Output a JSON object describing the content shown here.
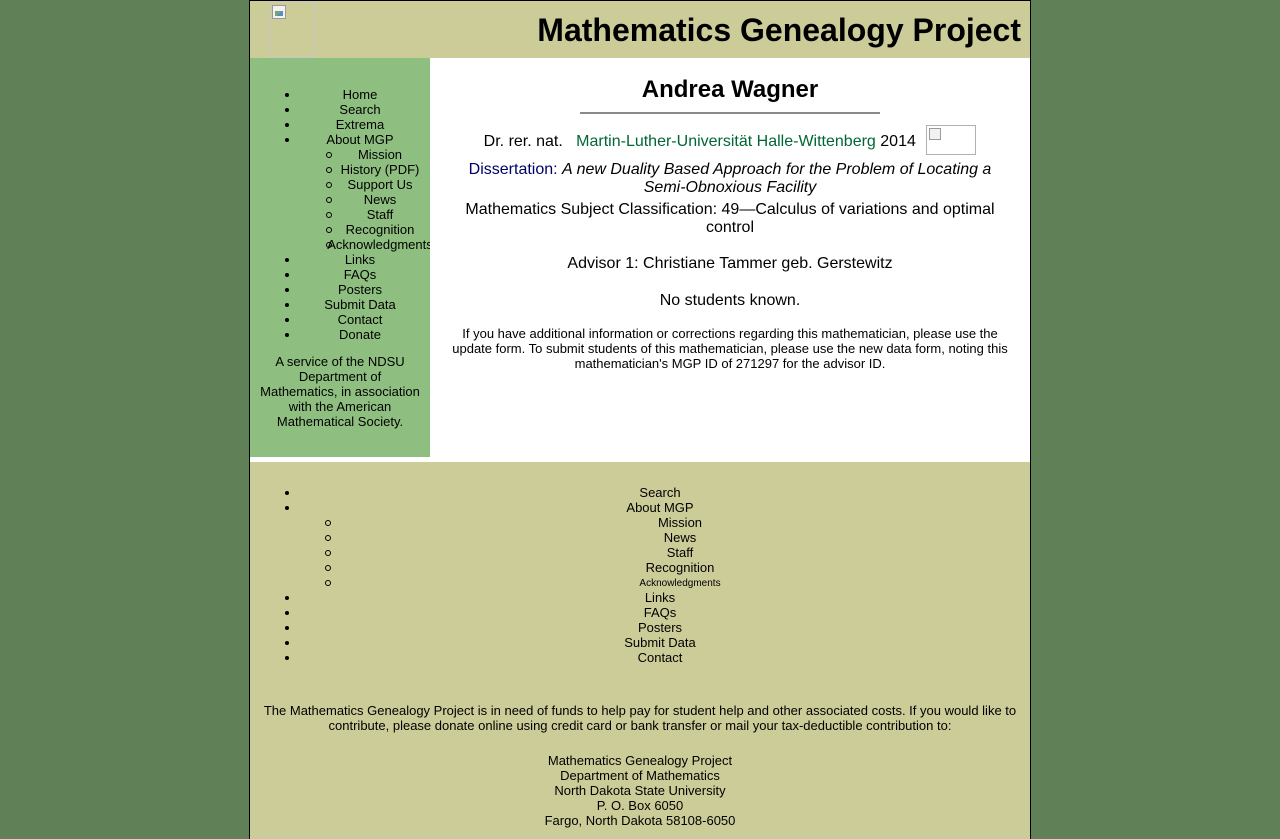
{
  "header": {
    "title": "Mathematics Genealogy Project",
    "logo_icon": "mgp-logo-broken-image-icon"
  },
  "sidebar": {
    "items": [
      {
        "label": "Home",
        "level": 1
      },
      {
        "label": "Search",
        "level": 1
      },
      {
        "label": "Extrema",
        "level": 1
      },
      {
        "label": "About MGP",
        "level": 1
      },
      {
        "label": "Mission",
        "level": 2
      },
      {
        "label": "History (PDF)",
        "level": 2
      },
      {
        "label": "Support Us",
        "level": 2
      },
      {
        "label": "News",
        "level": 2
      },
      {
        "label": "Staff",
        "level": 2
      },
      {
        "label": "Recognition",
        "level": 2
      },
      {
        "label": "Acknowledgments",
        "level": 2
      },
      {
        "label": "Links",
        "level": 1
      },
      {
        "label": "FAQs",
        "level": 1
      },
      {
        "label": "Posters",
        "level": 1
      },
      {
        "label": "Submit Data",
        "level": 1
      },
      {
        "label": "Contact",
        "level": 1
      },
      {
        "label": "Donate",
        "level": 1
      }
    ],
    "service_lines": [
      "A service of the NDSU",
      "Department of",
      "Mathematics, in association",
      "with the American",
      "Mathematical Society."
    ]
  },
  "main": {
    "name": "Andrea Wagner",
    "degree": "Dr. rer. nat.",
    "university": "Martin-Luther-Universität Halle-Wittenberg",
    "year": "2014",
    "flag_icon": "country-flag-broken-image-icon",
    "dissertation_label": "Dissertation:",
    "dissertation_title": "A new Duality Based Approach for the Problem of Locating a Semi-Obnoxious Facility",
    "msc": "Mathematics Subject Classification: 49—Calculus of variations and optimal control",
    "advisor": "Advisor 1: Christiane Tammer geb. Gerstewitz",
    "students": "No students known.",
    "update_note": "If you have additional information or corrections regarding this mathematician, please use the update form. To submit students of this mathematician, please use the new data form, noting this mathematician's MGP ID of 271297 for the advisor ID."
  },
  "footer": {
    "items": [
      {
        "label": "Search",
        "level": 1
      },
      {
        "label": "About MGP",
        "level": 1
      },
      {
        "label": "Mission",
        "level": 2
      },
      {
        "label": "News",
        "level": 2
      },
      {
        "label": "Staff",
        "level": 2
      },
      {
        "label": "Recognition",
        "level": 2
      },
      {
        "label": "Acknowledgments",
        "level": 2,
        "small": true
      },
      {
        "label": "Links",
        "level": 1
      },
      {
        "label": "FAQs",
        "level": 1
      },
      {
        "label": "Posters",
        "level": 1
      },
      {
        "label": "Submit Data",
        "level": 1
      },
      {
        "label": "Contact",
        "level": 1
      }
    ],
    "funds_note": "The Mathematics Genealogy Project is in need of funds to help pay for student help and other associated costs. If you would like to contribute, please donate online using credit card or bank transfer or mail your tax-deductible contribution to:",
    "address_lines": [
      "Mathematics Genealogy Project",
      "Department of Mathematics",
      "North Dakota State University",
      "P. O. Box 6050",
      "Fargo, North Dakota 58108-6050"
    ]
  },
  "colors": {
    "page_background": "#608058",
    "header_background": "#cccc99",
    "sidebar_background": "#8fbf80",
    "link_green": "#006633",
    "dissertation_label": "#000066"
  }
}
